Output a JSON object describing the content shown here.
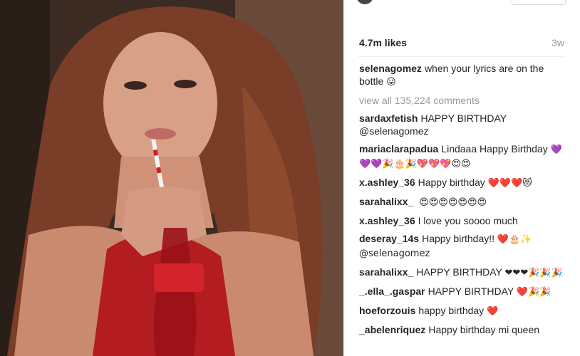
{
  "post": {
    "likes": "4.7m likes",
    "age": "3w",
    "caption_user": "selenagomez",
    "caption_text": "when your lyrics are on the bottle",
    "caption_emoji": "😛",
    "view_all": "view all 135,224 comments"
  },
  "comments": [
    {
      "user": "sardaxfetish",
      "text": "HAPPY BIRTHDAY @selenagomez",
      "emoji": ""
    },
    {
      "user": "mariaclarapadua",
      "text": "Lindaaa Happy Birthday",
      "emoji": "💜💜💜🎉🎂🎉💖💖💖😍😍"
    },
    {
      "user": "x.ashley_36",
      "text": "Happy birthday",
      "emoji": "❤️❤️❤️😻"
    },
    {
      "user": "sarahalixx_",
      "text": "",
      "emoji": "😍😍😍😍😍😍😍"
    },
    {
      "user": "x.ashley_36",
      "text": "I love you soooo much",
      "emoji": ""
    },
    {
      "user": "deseray_14s",
      "text": "Happy birthday!!",
      "emoji": "❤️🎂✨ @selenagomez"
    },
    {
      "user": "sarahalixx_",
      "text": "HAPPY BIRTHDAY",
      "emoji": "❤❤❤🎉🎉🎉"
    },
    {
      "user": "_.ella_.gaspar",
      "text": "HAPPY BIRTHDAY",
      "emoji": "❤️🎉🎉"
    },
    {
      "user": "hoeforzouis",
      "text": "happy birthday",
      "emoji": "❤️"
    },
    {
      "user": "_abelenriquez",
      "text": "Happy birthday mi queen",
      "emoji": ""
    }
  ],
  "colors": {
    "text": "#262626",
    "muted": "#999999"
  }
}
